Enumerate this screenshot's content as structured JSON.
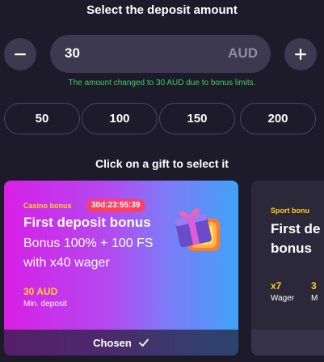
{
  "header": {
    "title": "Select the deposit amount"
  },
  "amount": {
    "value": "30",
    "currency": "AUD",
    "decrease_icon": "minus-icon",
    "increase_icon": "plus-icon",
    "notice": "The amount changed to 30 AUD due to bonus limits.",
    "presets": [
      "50",
      "100",
      "150",
      "200"
    ]
  },
  "gifts": {
    "subtitle": "Click on a gift to select it",
    "cards": [
      {
        "tag": "Casino bonus",
        "timer": "30d:23:55:39",
        "title": "First deposit bonus",
        "description": "Bonus 100% + 100 FS with x40 wager",
        "min_value": "30 AUD",
        "min_label": "Min. deposit",
        "footer": "Chosen",
        "footer_icon": "checkmark-icon",
        "image": "gift-box-icon"
      },
      {
        "tag": "Sport bonu",
        "title": "First de bonus",
        "title_line1": "First de",
        "title_line2": "bonus",
        "stats": [
          {
            "value": "x7",
            "label": "Wager"
          },
          {
            "value": "3",
            "label": "M"
          }
        ]
      }
    ]
  },
  "colors": {
    "background": "#1d1a2a",
    "control": "#3c3950",
    "notice_green": "#3ecf5a",
    "accent_yellow": "#ffd21f",
    "timer_red": "#ff3e64",
    "card_gradient_start": "#d81fe6",
    "card_gradient_end": "#3fa3f8"
  }
}
